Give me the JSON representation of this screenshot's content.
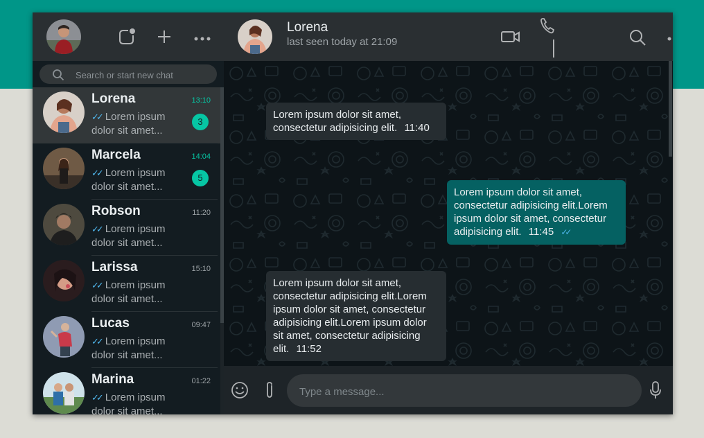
{
  "colors": {
    "brand": "#009688",
    "accent": "#06c6a4",
    "outgoing_bubble": "#056162",
    "incoming_bubble": "#262d31",
    "read_ticks": "#4fb6ec"
  },
  "sidebar": {
    "header": {
      "icons": [
        "status-icon",
        "new-chat-icon",
        "menu-icon"
      ]
    },
    "search": {
      "placeholder": "Search or start new chat"
    },
    "chats": [
      {
        "name": "Lorena",
        "time": "13:10",
        "preview": "Lorem ipsum dolor sit amet...",
        "unread": "3",
        "active": true
      },
      {
        "name": "Marcela",
        "time": "14:04",
        "preview": "Lorem ipsum dolor sit amet...",
        "unread": "5"
      },
      {
        "name": "Robson",
        "time": "11:20",
        "preview": "Lorem ipsum dolor sit amet..."
      },
      {
        "name": "Larissa",
        "time": "15:10",
        "preview": "Lorem ipsum dolor sit amet..."
      },
      {
        "name": "Lucas",
        "time": "09:47",
        "preview": "Lorem ipsum dolor sit amet..."
      },
      {
        "name": "Marina",
        "time": "01:22",
        "preview": "Lorem ipsum dolor sit amet..."
      }
    ]
  },
  "conversation": {
    "contact": {
      "name": "Lorena",
      "status": "last seen today at 21:09"
    },
    "header_icons": [
      "video-call-icon",
      "voice-call-icon",
      "search-icon",
      "menu-icon"
    ],
    "messages": [
      {
        "direction": "in",
        "text": "Lorem ipsum dolor sit amet, consectetur adipisicing elit.",
        "time": "11:40"
      },
      {
        "direction": "out",
        "text": "Lorem ipsum dolor sit amet, consectetur adipisicing elit.Lorem ipsum dolor sit amet, consectetur adipisicing elit.",
        "time": "11:45",
        "read": true
      },
      {
        "direction": "in",
        "text": "Lorem ipsum dolor sit amet, consectetur adipisicing elit.Lorem ipsum dolor sit amet, consectetur adipisicing elit.Lorem ipsum dolor sit amet, consectetur adipisicing elit.",
        "time": "11:52"
      }
    ],
    "composer": {
      "placeholder": "Type a message...",
      "icons": [
        "emoji-icon",
        "attach-icon",
        "microphone-icon"
      ]
    }
  }
}
